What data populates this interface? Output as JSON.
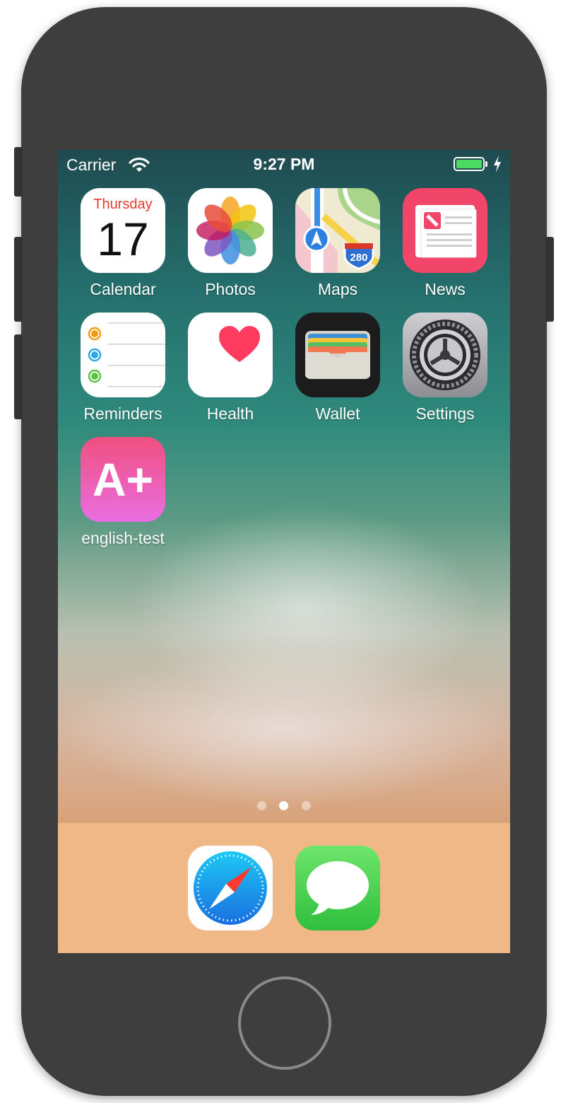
{
  "status_bar": {
    "carrier": "Carrier",
    "time": "9:27 PM",
    "battery_level": 1.0,
    "charging": true,
    "wifi_icon": "wifi-icon",
    "battery_color": "#4cd964"
  },
  "home_screen": {
    "apps": [
      {
        "label": "Calendar",
        "icon": "calendar-icon",
        "weekday": "Thursday",
        "date": "17"
      },
      {
        "label": "Photos",
        "icon": "photos-icon"
      },
      {
        "label": "Maps",
        "icon": "maps-icon",
        "shield": "280"
      },
      {
        "label": "News",
        "icon": "news-icon"
      },
      {
        "label": "Reminders",
        "icon": "reminders-icon"
      },
      {
        "label": "Health",
        "icon": "health-heart-icon"
      },
      {
        "label": "Wallet",
        "icon": "wallet-icon"
      },
      {
        "label": "Settings",
        "icon": "gear-icon"
      },
      {
        "label": "english-test",
        "icon": "a-plus-icon",
        "glyph": "A+"
      }
    ],
    "page_dots": {
      "count": 3,
      "active_index": 1
    }
  },
  "dock": {
    "apps": [
      {
        "icon": "safari-compass-icon"
      },
      {
        "icon": "messages-bubble-icon"
      }
    ]
  },
  "device": {
    "home_button_icon": "home-button"
  }
}
